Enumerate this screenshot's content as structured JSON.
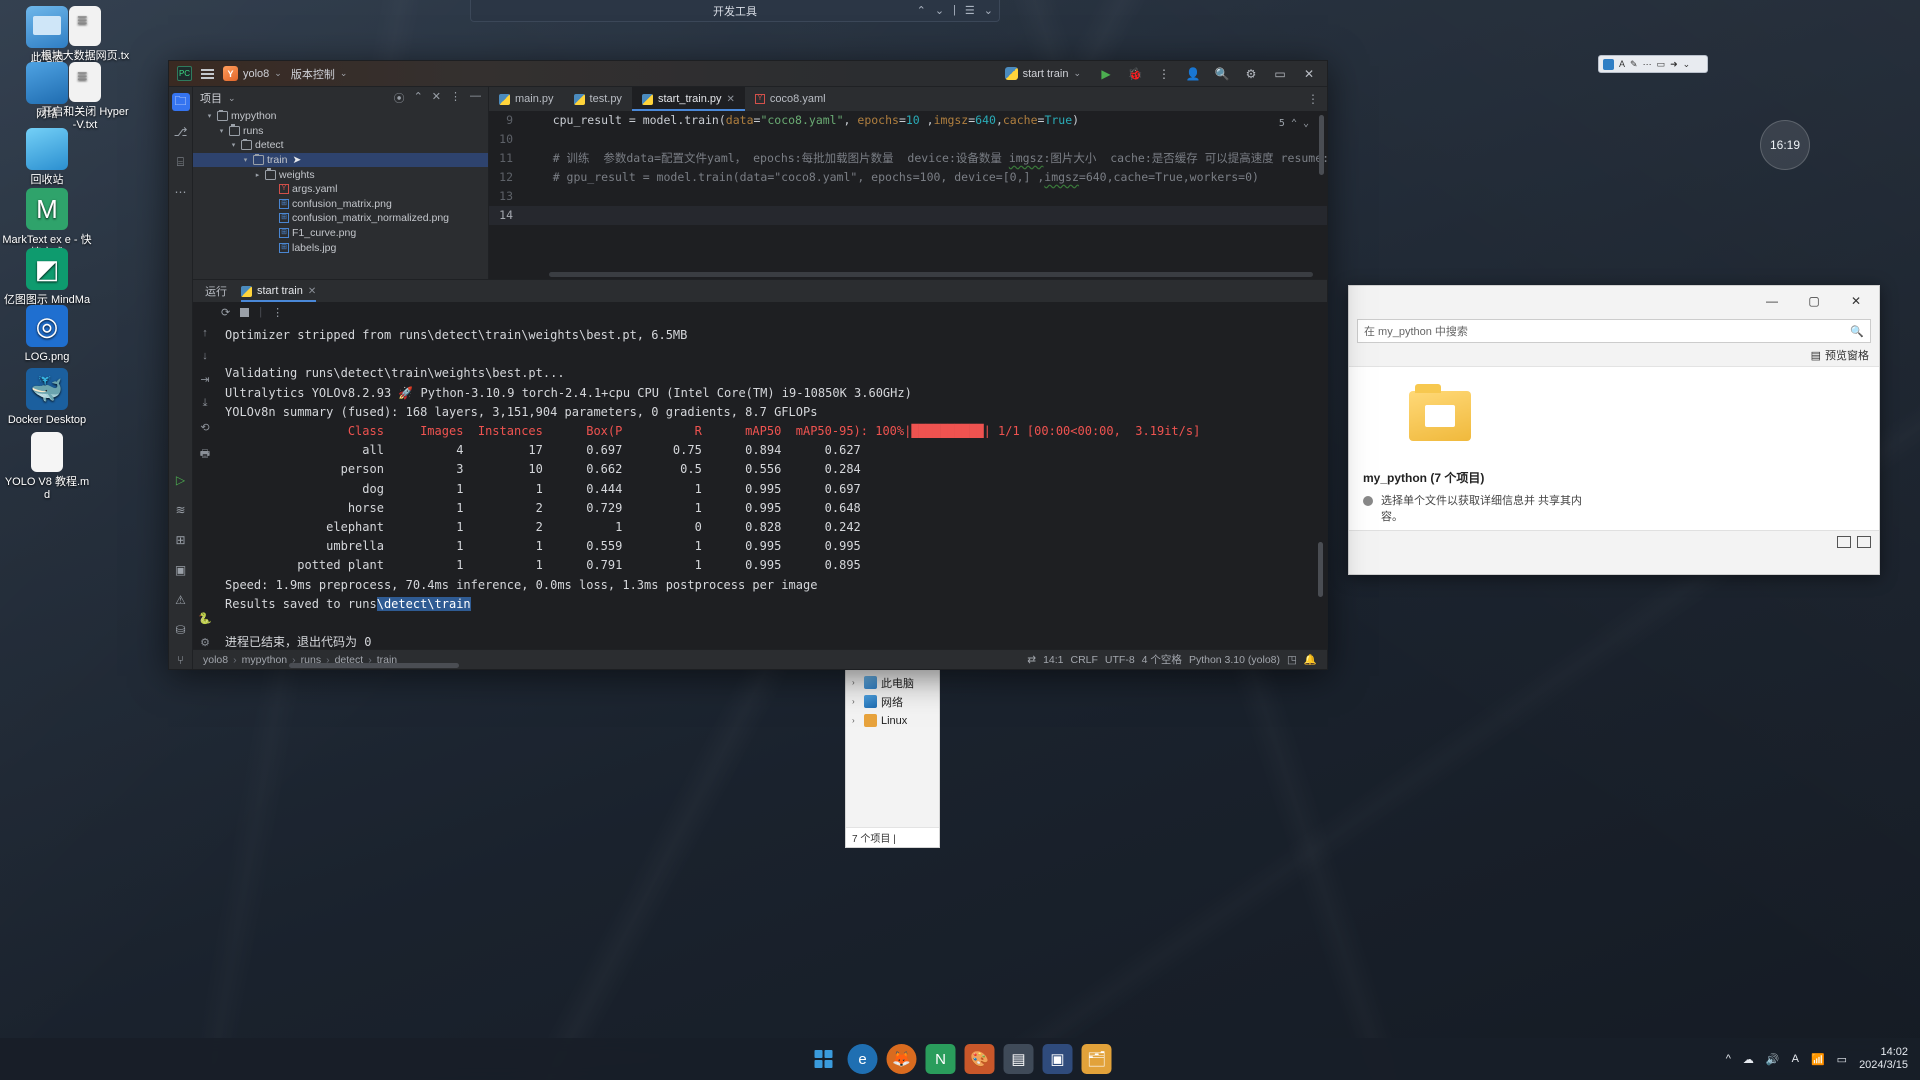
{
  "desktop": {
    "icons": [
      {
        "name": "此电脑",
        "type": "pc"
      },
      {
        "name": "根块大数据网页.txt",
        "type": "txt"
      },
      {
        "name": "网络",
        "type": "net"
      },
      {
        "name": "开启和关闭 Hyper-V.txt",
        "type": "txt"
      },
      {
        "name": "回收站",
        "type": "bin"
      },
      {
        "name": "MarkText ex e - 快捷方式",
        "type": "mark"
      },
      {
        "name": "亿图图示 MindMaster",
        "type": "mind"
      },
      {
        "name": "LOG.png",
        "type": "log"
      },
      {
        "name": "Docker Desktop",
        "type": "docker"
      },
      {
        "name": "YOLO V8 教程.md",
        "type": "md"
      }
    ]
  },
  "topbar": {
    "title": "开发工具",
    "controls": [
      "⌃",
      "⌄",
      "|",
      "☰",
      "⌄"
    ]
  },
  "clock_widget": {
    "time": "16:19"
  },
  "explorer": {
    "window_buttons": [
      "—",
      "▢",
      "✕"
    ],
    "search_placeholder": "在 my_python 中搜索",
    "view_label": "预览窗格",
    "folder_caption": "my_python (7 个项目)",
    "note": "选择单个文件以获取详细信息并 共享其内容。",
    "status": ""
  },
  "nav_window": {
    "items": [
      {
        "label": "此电脑",
        "icon": "pc-icon"
      },
      {
        "label": "网络",
        "icon": "network-icon"
      },
      {
        "label": "Linux",
        "icon": "linux-icon"
      }
    ],
    "footer": "7 个项目 |"
  },
  "ide": {
    "title": {
      "project": "yolo8",
      "vcs": "版本控制",
      "run_config": "start train",
      "buttons": [
        "play-icon",
        "debug-icon",
        "more-icon",
        "account-icon",
        "search-icon",
        "settings-icon",
        "minimize",
        "close"
      ]
    },
    "project_panel": {
      "title": "项目",
      "actions": [
        "target-icon",
        "sort-icon",
        "collapse-icon",
        "more-icon",
        "hide-icon"
      ]
    },
    "tree": [
      {
        "label": "mypython",
        "depth": 0,
        "type": "folder",
        "arrow": "v",
        "selected": false
      },
      {
        "label": "runs",
        "depth": 1,
        "type": "folder",
        "arrow": "v",
        "selected": false
      },
      {
        "label": "detect",
        "depth": 2,
        "type": "folder",
        "arrow": "v",
        "selected": false
      },
      {
        "label": "train",
        "depth": 3,
        "type": "folder",
        "arrow": "v",
        "selected": true
      },
      {
        "label": "weights",
        "depth": 4,
        "type": "folder",
        "arrow": ">",
        "selected": false
      },
      {
        "label": "args.yaml",
        "depth": 5,
        "type": "yaml",
        "arrow": "",
        "selected": false
      },
      {
        "label": "confusion_matrix.png",
        "depth": 5,
        "type": "png",
        "arrow": "",
        "selected": false
      },
      {
        "label": "confusion_matrix_normalized.png",
        "depth": 5,
        "type": "png",
        "arrow": "",
        "selected": false
      },
      {
        "label": "F1_curve.png",
        "depth": 5,
        "type": "png",
        "arrow": "",
        "selected": false
      },
      {
        "label": "labels.jpg",
        "depth": 5,
        "type": "png",
        "arrow": "",
        "selected": false
      }
    ],
    "tabs": [
      {
        "label": "main.py",
        "type": "py",
        "active": false,
        "closable": false
      },
      {
        "label": "test.py",
        "type": "py",
        "active": false,
        "closable": false
      },
      {
        "label": "start_train.py",
        "type": "py",
        "active": true,
        "closable": true
      },
      {
        "label": "coco8.yaml",
        "type": "yaml",
        "active": false,
        "closable": false
      }
    ],
    "code": [
      {
        "num": "9",
        "segments": [
          {
            "t": "    cpu_result = model.train(",
            "c": "k-var"
          },
          {
            "t": "data",
            "c": "k-arg"
          },
          {
            "t": "=",
            "c": "k-op"
          },
          {
            "t": "\"coco8.yaml\"",
            "c": "k-str"
          },
          {
            "t": ", ",
            "c": "k-op"
          },
          {
            "t": "epochs",
            "c": "k-arg"
          },
          {
            "t": "=",
            "c": "k-op"
          },
          {
            "t": "10",
            "c": "k-num"
          },
          {
            "t": " ,",
            "c": "k-op"
          },
          {
            "t": "imgsz",
            "c": "k-arg"
          },
          {
            "t": "=",
            "c": "k-op"
          },
          {
            "t": "640",
            "c": "k-num"
          },
          {
            "t": ",",
            "c": "k-op"
          },
          {
            "t": "cache",
            "c": "k-arg"
          },
          {
            "t": "=",
            "c": "k-op"
          },
          {
            "t": "True",
            "c": "k-num"
          },
          {
            "t": ")",
            "c": "k-op"
          }
        ]
      },
      {
        "num": "10",
        "segments": []
      },
      {
        "num": "11",
        "segments": [
          {
            "t": "    # 训练  参数data=配置文件yaml， epochs:每批加载图片数量  device:设备数量 ",
            "c": "k-cmt"
          },
          {
            "t": "imgsz",
            "c": "k-cmt wavy"
          },
          {
            "t": ":图片大小  cache:是否缓存 可以提高速度 resume:继传",
            "c": "k-cmt"
          }
        ]
      },
      {
        "num": "12",
        "segments": [
          {
            "t": "    # gpu_result = model.train(data=\"coco8.yaml\", epochs=100, device=[0,] ,",
            "c": "k-cmt"
          },
          {
            "t": "imgsz",
            "c": "k-cmt wavy"
          },
          {
            "t": "=640,cache=True,workers=0)",
            "c": "k-cmt"
          }
        ]
      },
      {
        "num": "13",
        "segments": []
      },
      {
        "num": "14",
        "segments": [],
        "current": true
      }
    ],
    "code_hint": "5",
    "run_window": {
      "label": "运行",
      "tab": "start train",
      "toolbar": [
        "rerun-icon",
        "stop-icon",
        "more-icon"
      ],
      "side_icons": [
        "up-icon",
        "down-icon",
        "wrap-icon",
        "scroll-end-icon",
        "clear-icon",
        "print-icon",
        "soft-wrap-icon",
        "settings-icon"
      ],
      "console": [
        {
          "text": "Optimizer stripped from runs\\detect\\train\\weights\\best.pt, 6.5MB"
        },
        {
          "text": ""
        },
        {
          "text": "Validating runs\\detect\\train\\weights\\best.pt..."
        },
        {
          "text": "Ultralytics YOLOv8.2.93 🚀 Python-3.10.9 torch-2.4.1+cpu CPU (Intel Core(TM) i9-10850K 3.60GHz)"
        },
        {
          "text": "YOLOv8n summary (fused): 168 layers, 3,151,904 parameters, 0 gradients, 8.7 GFLOPs"
        },
        {
          "text": "                 Class     Images  Instances      Box(P          R      mAP50  mAP50-95): 100%|██████████| 1/1 [00:00<00:00,  3.19it/s]",
          "bar": true
        },
        {
          "text": "                   all          4         17      0.697       0.75      0.894      0.627"
        },
        {
          "text": "                person          3         10      0.662        0.5      0.556      0.284"
        },
        {
          "text": "                   dog          1          1      0.444          1      0.995      0.697"
        },
        {
          "text": "                 horse          1          2      0.729          1      0.995      0.648"
        },
        {
          "text": "              elephant          1          2          1          0      0.828      0.242"
        },
        {
          "text": "              umbrella          1          1      0.559          1      0.995      0.995"
        },
        {
          "text": "          potted plant          1          1      0.791          1      0.995      0.895"
        },
        {
          "text": "Speed: 1.9ms preprocess, 70.4ms inference, 0.0ms loss, 1.3ms postprocess per image"
        },
        {
          "text": "Results saved to runs",
          "hl": "\\detect\\train"
        },
        {
          "text": ""
        },
        {
          "text": "进程已结束，退出代码为 0"
        }
      ]
    },
    "status_bar": {
      "crumbs": [
        "yolo8",
        "mypython",
        "runs",
        "detect",
        "train"
      ],
      "caret": "14:1",
      "line_sep": "CRLF",
      "encoding": "UTF-8",
      "indent": "4 个空格",
      "interpreter": "Python 3.10 (yolo8)"
    }
  },
  "taskbar": {
    "items": [
      "start-icon",
      "edge-icon",
      "firefox-icon",
      "app-green-icon",
      "paint-icon",
      "app-orange-icon",
      "terminal-icon",
      "editor-icon",
      "explorer-icon"
    ],
    "tray": [
      "^",
      "cloud-icon",
      "sound-icon",
      "keyboard-icon",
      "network-icon",
      "battery-icon"
    ],
    "time": "14:02",
    "date": "2024/3/15"
  },
  "colors": {
    "accent": "#3574f0",
    "selection": "#2e436e",
    "ide_bg": "#2b2d30",
    "editor_bg": "#1e1f22",
    "progress": "#ef5350"
  }
}
